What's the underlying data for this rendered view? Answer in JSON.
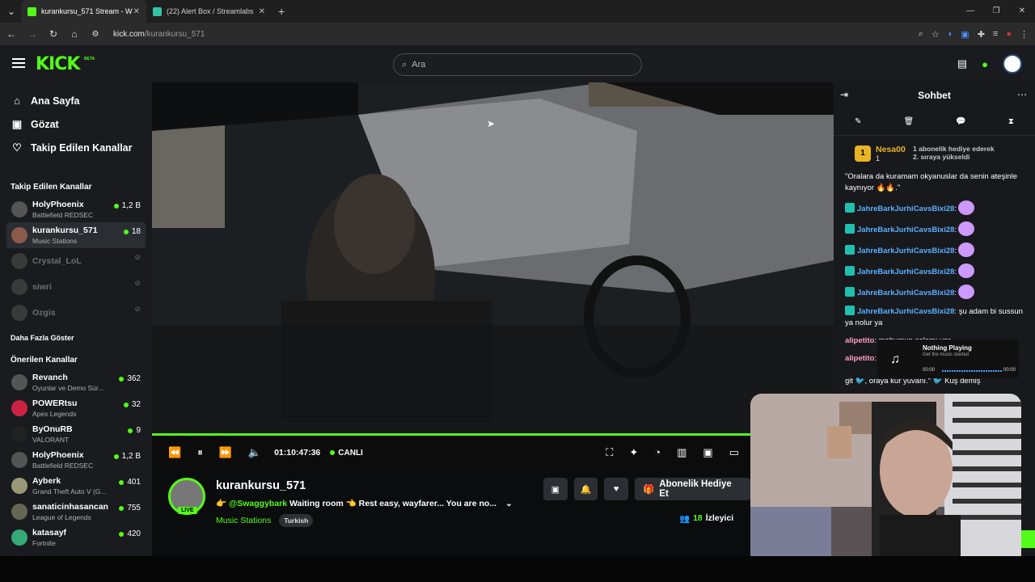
{
  "browser": {
    "tabs": [
      {
        "title": "kurankursu_571 Stream - W",
        "active": true
      },
      {
        "title": "(22) Alert Box / Streamlabs",
        "active": false
      }
    ],
    "url_host": "kick.com",
    "url_path": "/kurankursu_571"
  },
  "header": {
    "logo": "KICK",
    "beta": "BETA",
    "search_placeholder": "Ara"
  },
  "sidebar": {
    "nav": [
      {
        "label": "Ana Sayfa",
        "icon": "home-icon"
      },
      {
        "label": "Gözat",
        "icon": "browse-icon"
      },
      {
        "label": "Takip Edilen Kanallar",
        "icon": "heart-icon"
      }
    ],
    "followed_title": "Takip Edilen Kanallar",
    "followed": [
      {
        "name": "HolyPhoenix",
        "category": "Battlefield REDSEC",
        "viewers": "1,2 B",
        "live": true
      },
      {
        "name": "kurankursu_571",
        "category": "Music Stations",
        "viewers": "18",
        "live": true
      },
      {
        "name": "Crystal_LoL",
        "category": "",
        "viewers": "",
        "live": false
      },
      {
        "name": "siwri",
        "category": "",
        "viewers": "",
        "live": false
      },
      {
        "name": "Ozgis",
        "category": "",
        "viewers": "",
        "live": false
      }
    ],
    "show_more": "Daha Fazla Göster",
    "recommended_title": "Önerilen Kanallar",
    "recommended": [
      {
        "name": "Revanch",
        "category": "Oyunlar ve Demo Sür...",
        "viewers": "362"
      },
      {
        "name": "POWERtsu",
        "category": "Apex Legends",
        "viewers": "32"
      },
      {
        "name": "ByOnuRB",
        "category": "VALORANT",
        "viewers": "9"
      },
      {
        "name": "HolyPhoenix",
        "category": "Battlefield REDSEC",
        "viewers": "1,2 B"
      },
      {
        "name": "Ayberk",
        "category": "Grand Theft Auto V (G...",
        "viewers": "401"
      },
      {
        "name": "sanaticinhasancan",
        "category": "League of Legends",
        "viewers": "755"
      },
      {
        "name": "katasayf",
        "category": "Fortnite",
        "viewers": "420"
      }
    ]
  },
  "player": {
    "time": "01:10:47:36",
    "live_label": "CANLI"
  },
  "stream": {
    "channel": "kurankursu_571",
    "live_badge": "LIVE",
    "desc_emoji": "👉",
    "mention": "@Swaggybark",
    "desc": "Waiting room 👈 Rest easy, wayfarer... You are no...",
    "category": "Music Stations",
    "tag": "Turkish",
    "gift_label": "Abonelik Hediye Et",
    "viewers_count": "18",
    "viewers_label": "İzleyici"
  },
  "chat": {
    "title": "Sohbet",
    "pinned": {
      "rank": "1",
      "name": "Nesa00",
      "count": "1",
      "note_line1": "1 abonelik hediye ederek",
      "note_line2": "2. sıraya yükseldi"
    },
    "messages": [
      {
        "user": "",
        "text": "\"Oralara da kuramam okyanuslar da senin ateşinle kaynıyor 🔥🔥.\""
      },
      {
        "user": "JahreBarkJurhiCavsBixi28",
        "text": ""
      },
      {
        "user": "JahreBarkJurhiCavsBixi28",
        "text": ""
      },
      {
        "user": "JahreBarkJurhiCavsBixi28",
        "text": ""
      },
      {
        "user": "JahreBarkJurhiCavsBixi28",
        "text": ""
      },
      {
        "user": "JahreBarkJurhiCavsBixi28",
        "text": ""
      },
      {
        "user": "JahreBarkJurhiCavsBixi28",
        "text": "şu adam bi sussun ya nolur ya"
      },
      {
        "user": "alipetito",
        "text": "mahumun selamı var"
      },
      {
        "user": "alipetito",
        "text": ""
      }
    ],
    "partial_line": "git 🐦, oraya kur yuvanı.\" 🐦 Kuş demiş"
  },
  "music": {
    "title": "Nothing Playing",
    "subtitle": "Get the music started",
    "start": "00:00",
    "end": "00:00"
  }
}
